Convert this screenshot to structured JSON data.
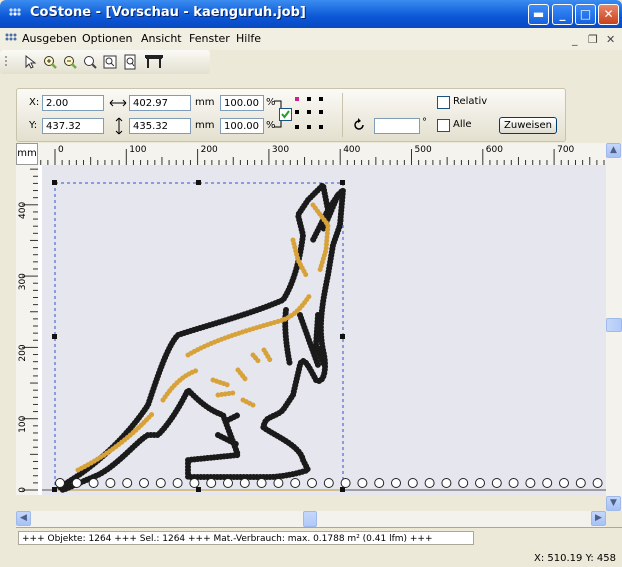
{
  "window": {
    "title": "CoStone - [Vorschau - kaenguruh.job]"
  },
  "menu": {
    "items": [
      "Ausgeben",
      "Optionen",
      "Ansicht",
      "Fenster",
      "Hilfe"
    ]
  },
  "position_bar": {
    "x_label": "X:",
    "x_value": "2.00",
    "y_label": "Y:",
    "y_value": "437.32",
    "width_value": "402.97",
    "height_value": "435.32",
    "unit1": "mm",
    "unit2": "mm",
    "scale_x": "100.00",
    "scale_y": "100.00",
    "percent1": "%",
    "percent2": "%",
    "relative_label": "Relativ",
    "all_label": "Alle",
    "angle_value": "",
    "degree": "°",
    "assign_label": "Zuweisen"
  },
  "ruler": {
    "unit": "mm",
    "h_ticks": [
      "0",
      "100",
      "200",
      "300",
      "400",
      "500",
      "600",
      "700"
    ],
    "v_ticks": [
      "400",
      "300",
      "200",
      "100",
      "0"
    ]
  },
  "status": {
    "text": "+++ Objekte: 1264 +++ Sel.: 1264 +++ Mat.-Verbrauch: max. 0.1788 m² (0.41 lfm) +++",
    "coords": "X: 510.19 Y: 458"
  },
  "colors": {
    "titlebar": "#0b57d6",
    "canvas": "#e6e6ef",
    "stone_dark": "#1a1a1a",
    "stone_gold": "#d8a23a"
  }
}
